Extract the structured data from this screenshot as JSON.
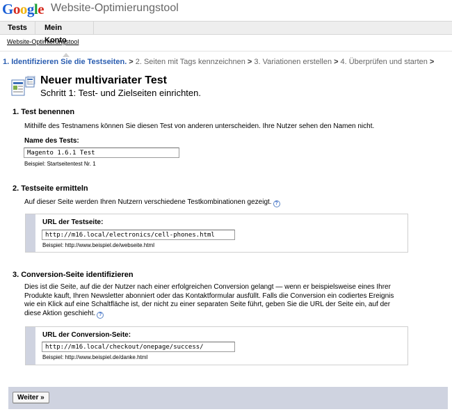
{
  "header": {
    "logo_letters": [
      "G",
      "o",
      "o",
      "g",
      "l",
      "e"
    ],
    "logo_colors": [
      "#1a5fd6",
      "#d62b1f",
      "#f1b512",
      "#1a5fd6",
      "#1a9e36",
      "#d62b1f"
    ],
    "product_name": "Website-Optimierungstool"
  },
  "nav": {
    "tabs": [
      {
        "label": "Tests"
      },
      {
        "label": "Mein Konto"
      }
    ]
  },
  "breadcrumb": "Website-Optimierungstool",
  "wizard": {
    "steps": [
      "1. Identifizieren Sie die Testseiten.",
      "2. Seiten mit Tags kennzeichnen",
      "3. Variationen erstellen",
      "4. Überprüfen und starten"
    ],
    "separator": ">"
  },
  "title": {
    "heading": "Neuer multivariater Test",
    "subheading": "Schritt 1: Test- und Zielseiten einrichten."
  },
  "section1": {
    "heading": "1. Test benennen",
    "text": "Mithilfe des Testnamens können Sie diesen Test von anderen unterscheiden. Ihre Nutzer sehen den Namen nicht.",
    "field_label": "Name des Tests:",
    "field_value": "Magento 1.6.1 Test",
    "hint": "Beispiel: Startseitentest Nr. 1"
  },
  "section2": {
    "heading": "2. Testseite ermitteln",
    "text": "Auf dieser Seite werden Ihren Nutzern verschiedene Testkombinationen gezeigt.",
    "help_symbol": "?",
    "field_label": "URL der Testseite:",
    "field_value": "http://m16.local/electronics/cell-phones.html",
    "hint": "Beispiel: http://www.beispiel.de/webseite.html"
  },
  "section3": {
    "heading": "3. Conversion-Seite identifizieren",
    "text_lines": [
      "Dies ist die Seite, auf die der Nutzer nach einer erfolgreichen Conversion gelangt — wenn er beispielsweise eines Ihrer",
      "Produkte kauft, Ihren Newsletter abonniert oder das Kontaktformular ausfüllt. Falls die Conversion ein codiertes Ereignis",
      "wie ein Klick auf eine Schaltfläche ist, der nicht zu einer separaten Seite führt, geben Sie die URL der Seite ein, auf der",
      "diese Aktion geschieht."
    ],
    "help_symbol": "?",
    "field_label": "URL der Conversion-Seite:",
    "field_value": "http://m16.local/checkout/onepage/success/",
    "hint": "Beispiel: http://www.beispiel.de/danke.html"
  },
  "footer": {
    "next_label": "Weiter »"
  }
}
